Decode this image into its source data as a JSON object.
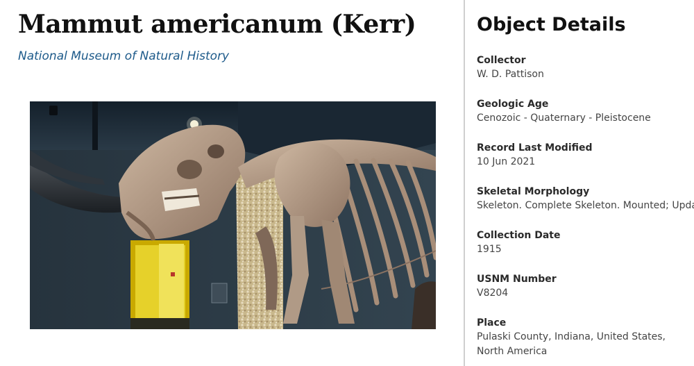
{
  "header": {
    "title": "Mammut americanum (Kerr)",
    "museum": "National Museum of Natural History"
  },
  "image": {
    "subject": "mastodon-skeleton-photo"
  },
  "details": {
    "heading": "Object Details",
    "items": [
      {
        "label": "Collector",
        "value": "W. D. Pattison"
      },
      {
        "label": "Geologic Age",
        "value": "Cenozoic - Quaternary - Pleistocene"
      },
      {
        "label": "Record Last Modified",
        "value": "10 Jun 2021"
      },
      {
        "label": "Skeletal Morphology",
        "value": "Skeleton. Complete Skeleton. Mounted; Updated"
      },
      {
        "label": "Collection Date",
        "value": "1915"
      },
      {
        "label": "USNM Number",
        "value": "V8204"
      },
      {
        "label": "Place",
        "value": "Pulaski County, Indiana, United States, North America"
      }
    ]
  },
  "colors": {
    "link": "#1d5a8a",
    "divider": "#cfcfcf"
  }
}
